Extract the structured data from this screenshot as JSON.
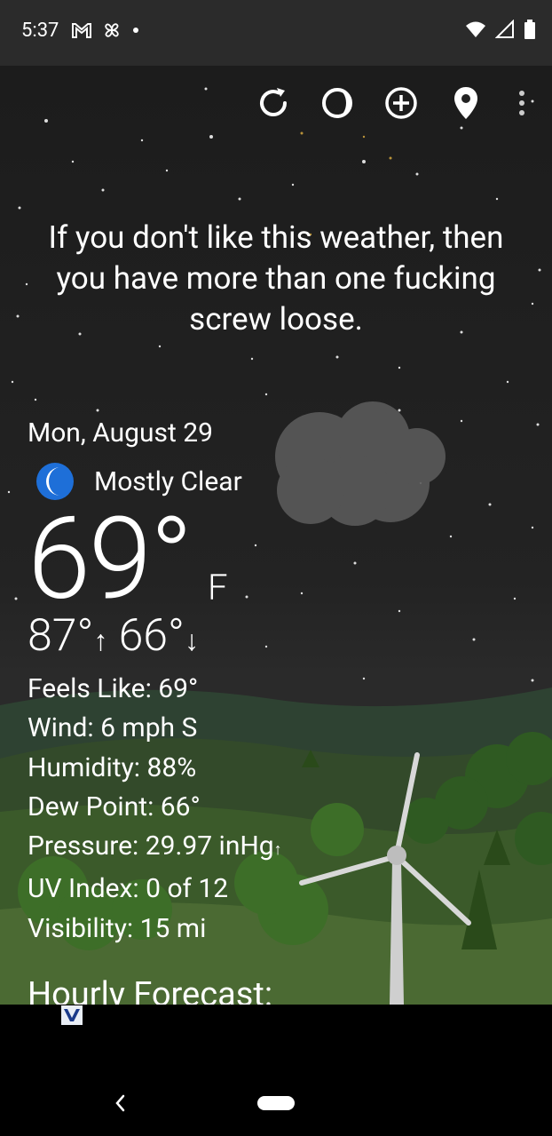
{
  "status": {
    "time": "5:37"
  },
  "quote": "If you don't like this weather, then you have more than one fucking screw loose.",
  "weather": {
    "date": "Mon, August 29",
    "condition": "Mostly Clear",
    "temperature": "69°",
    "unit": "F",
    "high": "87°",
    "low": "66°",
    "details": {
      "feels_like": "Feels Like:  69°",
      "wind": "Wind:  6 mph S",
      "humidity": "Humidity:  88%",
      "dew_point": "Dew Point:  66°",
      "pressure": "Pressure:  29.97 inHg",
      "uv_index": "UV Index:  0 of 12",
      "visibility": "Visibility:  15 mi"
    }
  },
  "hourly_title": "Hourly Forecast:",
  "icons": {
    "refresh": "refresh-icon",
    "theme": "theme-icon",
    "add": "add-location-icon",
    "location": "location-pin-icon",
    "menu": "more-vert-icon"
  }
}
